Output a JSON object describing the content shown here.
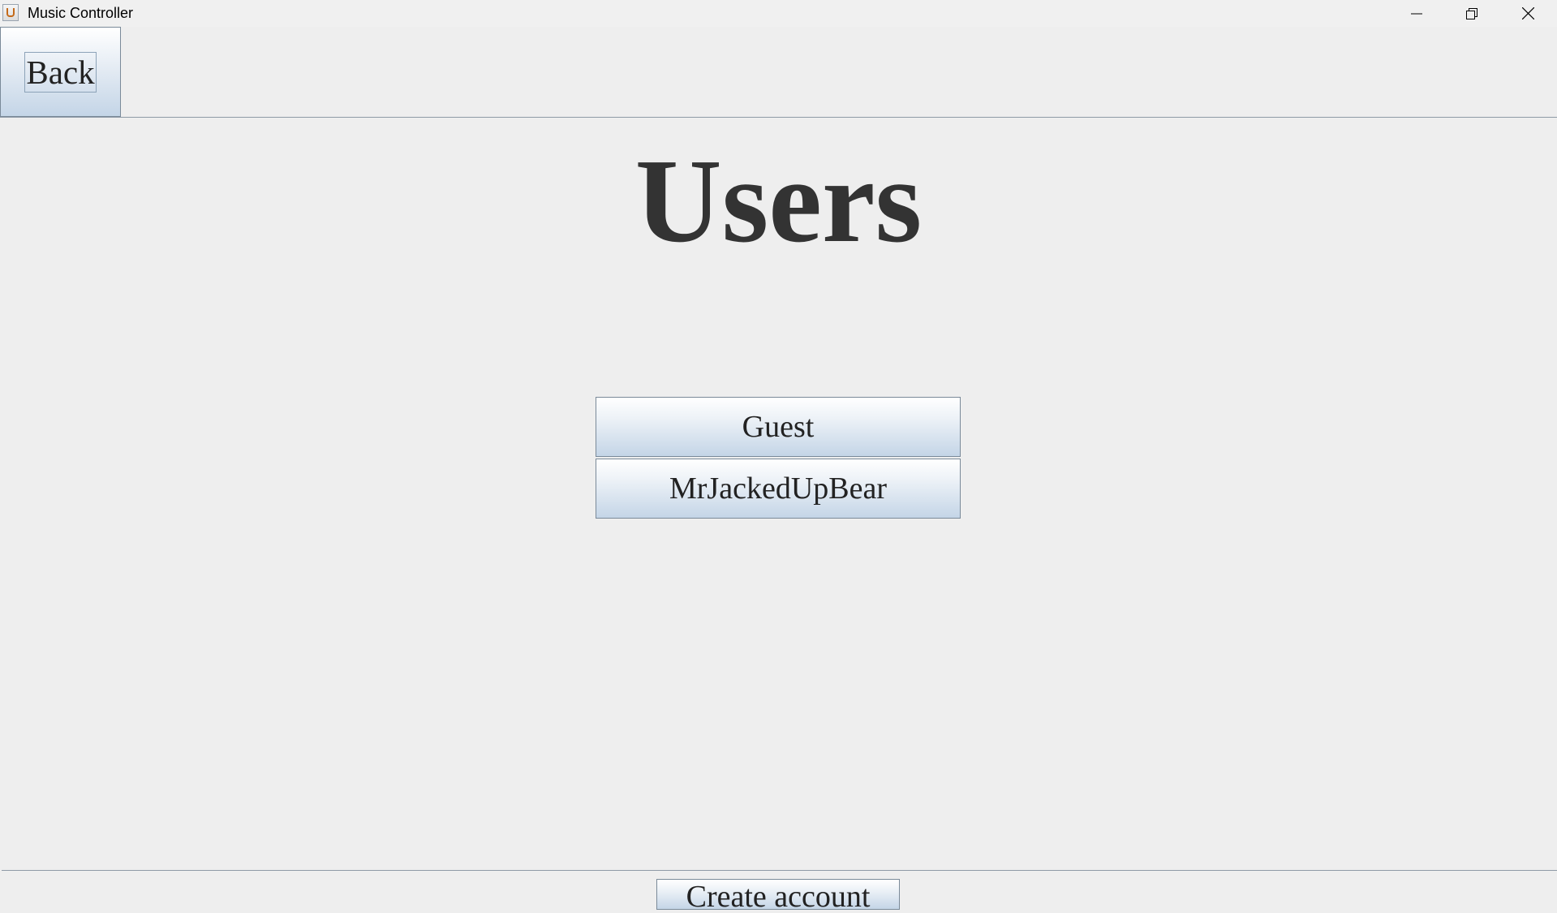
{
  "window": {
    "title": "Music Controller",
    "icons": {
      "app": "java-cup-icon",
      "minimize": "minimize-icon",
      "restore": "restore-icon",
      "close": "close-icon"
    }
  },
  "toolbar": {
    "back_label": "Back"
  },
  "main": {
    "heading": "Users",
    "users": [
      {
        "label": "Guest"
      },
      {
        "label": "MrJackedUpBear"
      }
    ]
  },
  "footer": {
    "create_account_label": "Create account"
  },
  "colors": {
    "background": "#eeeeee",
    "button_gradient_top": "#ffffff",
    "button_gradient_bottom": "#c4d5e7",
    "heading_text": "#333333"
  }
}
